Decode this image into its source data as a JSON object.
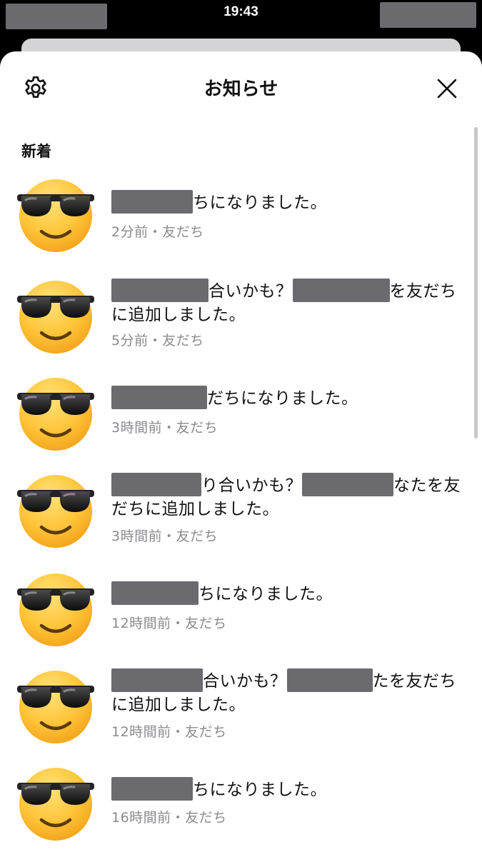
{
  "status_bar": {
    "time": "19:43"
  },
  "header": {
    "title": "お知らせ"
  },
  "section": {
    "label": "新着"
  },
  "notifications": [
    {
      "parts": [
        {
          "kind": "redacted",
          "width": 114
        },
        {
          "kind": "text",
          "value": "ちになりました。"
        }
      ],
      "meta": "2分前・友だち"
    },
    {
      "parts": [
        {
          "kind": "redacted",
          "width": 136
        },
        {
          "kind": "text",
          "value": "合いかも？"
        },
        {
          "kind": "redacted",
          "width": 136
        },
        {
          "kind": "text",
          "value": "を友だちに追加しました。"
        }
      ],
      "meta": "5分前・友だち"
    },
    {
      "parts": [
        {
          "kind": "redacted",
          "width": 134
        },
        {
          "kind": "text",
          "value": "だちになりました。"
        }
      ],
      "meta": "3時間前・友だち"
    },
    {
      "parts": [
        {
          "kind": "redacted",
          "width": 126
        },
        {
          "kind": "text",
          "value": "り合いかも？"
        },
        {
          "kind": "redacted",
          "width": 128
        },
        {
          "kind": "text",
          "value": "なたを友だちに追加しました。"
        }
      ],
      "meta": "3時間前・友だち"
    },
    {
      "parts": [
        {
          "kind": "redacted",
          "width": 122
        },
        {
          "kind": "text",
          "value": "ちになりました。"
        }
      ],
      "meta": "12時間前・友だち"
    },
    {
      "parts": [
        {
          "kind": "redacted",
          "width": 128
        },
        {
          "kind": "text",
          "value": "合いかも？"
        },
        {
          "kind": "redacted",
          "width": 120
        },
        {
          "kind": "text",
          "value": "たを友だちに追加しました。"
        }
      ],
      "meta": "12時間前・友だち"
    },
    {
      "parts": [
        {
          "kind": "redacted",
          "width": 114
        },
        {
          "kind": "text",
          "value": "ちになりました。"
        }
      ],
      "meta": "16時間前・友だち"
    }
  ]
}
